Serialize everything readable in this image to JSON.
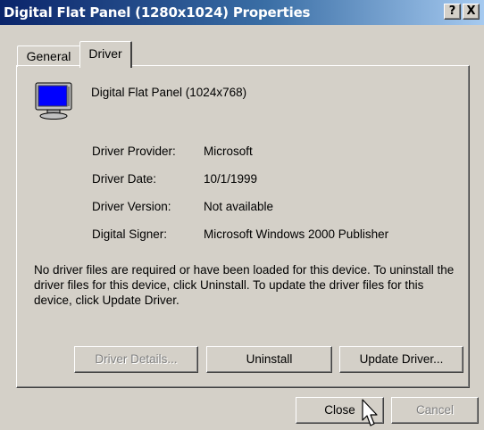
{
  "window": {
    "title": "Digital Flat Panel (1280x1024) Properties",
    "help_label": "?",
    "close_label": "X"
  },
  "tabs": [
    {
      "label": "General",
      "selected": false
    },
    {
      "label": "Driver",
      "selected": true
    }
  ],
  "device": {
    "name": "Digital Flat Panel (1024x768)",
    "icon": "monitor-icon"
  },
  "driver_info": [
    {
      "label": "Driver Provider:",
      "value": "Microsoft"
    },
    {
      "label": "Driver Date:",
      "value": "10/1/1999"
    },
    {
      "label": "Driver Version:",
      "value": "Not available"
    },
    {
      "label": "Digital Signer:",
      "value": "Microsoft Windows 2000 Publisher"
    }
  ],
  "description": "No driver files are required or have been loaded for this device. To uninstall the driver files for this device, click Uninstall. To update the driver files for this device, click Update Driver.",
  "buttons": {
    "driver_details": "Driver Details...",
    "uninstall": "Uninstall",
    "update_driver": "Update Driver...",
    "close": "Close",
    "cancel": "Cancel"
  },
  "colors": {
    "title_start": "#0a246a",
    "title_end": "#a6caf0",
    "face": "#d4d0c8"
  }
}
